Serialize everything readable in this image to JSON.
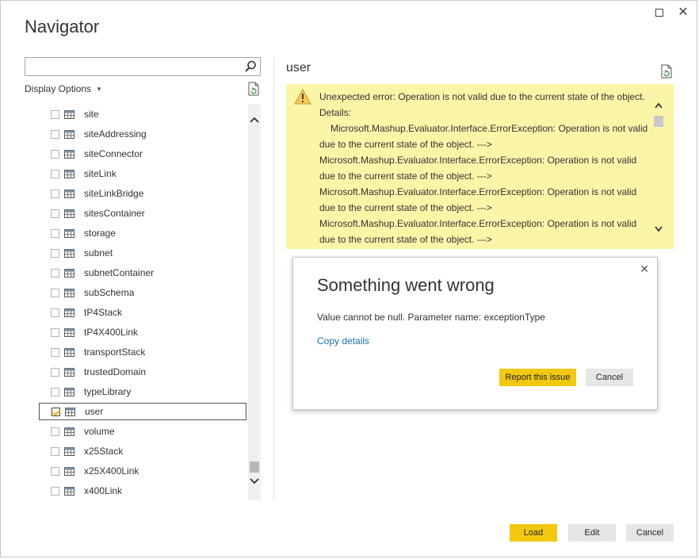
{
  "window": {
    "title": "Navigator",
    "maximize_icon": "maximize-icon",
    "close_glyph": "✕"
  },
  "search": {
    "value": "",
    "placeholder": ""
  },
  "display_options": {
    "label": "Display Options",
    "caret": "▼"
  },
  "tree": {
    "items": [
      {
        "label": "site",
        "checked": false
      },
      {
        "label": "siteAddressing",
        "checked": false
      },
      {
        "label": "siteConnector",
        "checked": false
      },
      {
        "label": "siteLink",
        "checked": false
      },
      {
        "label": "siteLinkBridge",
        "checked": false
      },
      {
        "label": "sitesContainer",
        "checked": false
      },
      {
        "label": "storage",
        "checked": false
      },
      {
        "label": "subnet",
        "checked": false
      },
      {
        "label": "subnetContainer",
        "checked": false
      },
      {
        "label": "subSchema",
        "checked": false
      },
      {
        "label": "tP4Stack",
        "checked": false
      },
      {
        "label": "tP4X400Link",
        "checked": false
      },
      {
        "label": "transportStack",
        "checked": false
      },
      {
        "label": "trustedDomain",
        "checked": false
      },
      {
        "label": "typeLibrary",
        "checked": false
      },
      {
        "label": "user",
        "checked": true
      },
      {
        "label": "volume",
        "checked": false
      },
      {
        "label": "x25Stack",
        "checked": false
      },
      {
        "label": "x25X400Link",
        "checked": false
      },
      {
        "label": "x400Link",
        "checked": false
      }
    ]
  },
  "preview": {
    "title": "user",
    "error": {
      "line1": "Unexpected error: Operation is not valid due to the current state of the object.",
      "line2": "Details:",
      "line3": "Microsoft.Mashup.Evaluator.Interface.ErrorException: Operation is not valid",
      "line4": "due to the current state of the object. --->",
      "line5": "Microsoft.Mashup.Evaluator.Interface.ErrorException: Operation is not valid",
      "line6": "due to the current state of the object. --->",
      "line7": "Microsoft.Mashup.Evaluator.Interface.ErrorException: Operation is not valid",
      "line8": "due to the current state of the object. --->",
      "line9": "Microsoft.Mashup.Evaluator.Interface.ErrorException: Operation is not valid",
      "line10": "due to the current state of the object. --->"
    }
  },
  "dialog": {
    "title": "Something went wrong",
    "message": "Value cannot be null. Parameter name: exceptionType",
    "link": "Copy details",
    "report_label": "Report this issue",
    "cancel_label": "Cancel",
    "close_glyph": "✕"
  },
  "footer": {
    "load_label": "Load",
    "edit_label": "Edit",
    "cancel_label": "Cancel"
  },
  "colors": {
    "accent": "#f2c811",
    "banner": "#fbf5a8",
    "link": "#1a6fb5"
  }
}
